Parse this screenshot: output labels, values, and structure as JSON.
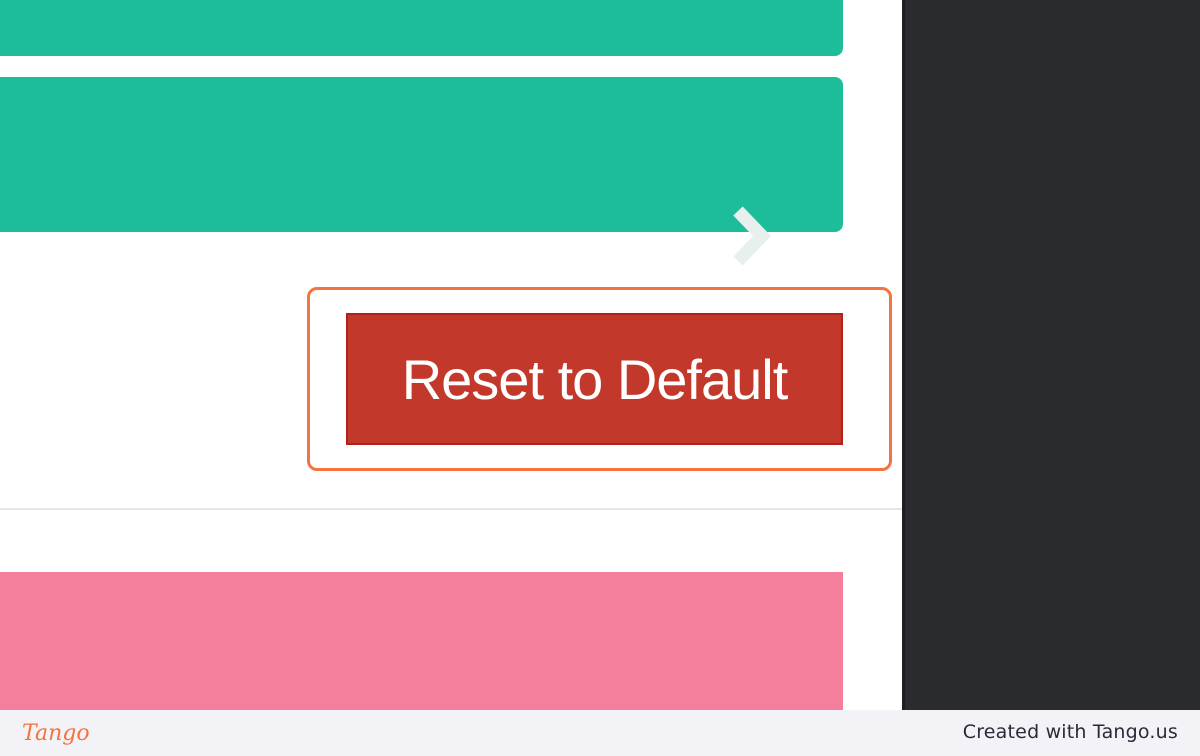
{
  "buttons": {
    "reset_label": "Reset to Default"
  },
  "icons": {
    "accordion_top": "chevron-right-icon",
    "accordion_main": "chevron-right-icon"
  },
  "colors": {
    "teal": "#1dbd9b",
    "reset_button": "#c2382b",
    "highlight": "#f4733f",
    "pink": "#f37f9d",
    "dark_panel": "#2a2b2e"
  },
  "footer": {
    "logo": "Tango",
    "credit": "Created with Tango.us"
  }
}
